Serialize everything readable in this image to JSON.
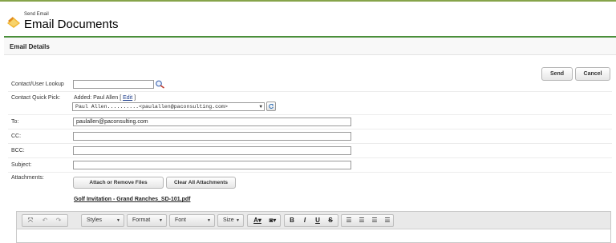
{
  "header": {
    "small_title": "Send Email",
    "title": "Email Documents"
  },
  "panel": {
    "heading": "Email Details"
  },
  "actions": {
    "send": "Send",
    "cancel": "Cancel"
  },
  "form": {
    "contact_lookup_label": "Contact/User Lookup",
    "contact_lookup_value": "",
    "quick_pick_label": "Contact Quick Pick:",
    "quick_pick_added_prefix": "Added: Paul Allen [",
    "quick_pick_edit": "Edit",
    "quick_pick_added_suffix": "]",
    "quick_pick_selected": "Paul Allen..........<paulallen@paconsulting.com>",
    "to_label": "To:",
    "to_value": "paulallen@paconsulting.com",
    "cc_label": "CC:",
    "cc_value": "",
    "bcc_label": "BCC:",
    "bcc_value": "",
    "subject_label": "Subject:",
    "subject_value": "",
    "attachments_label": "Attachments:",
    "attach_button": "Attach or Remove Files",
    "clear_button": "Clear All Attachments",
    "attachment_file": "Golf Invitation - Grand Ranches_SD-101.pdf"
  },
  "editor": {
    "styles": "Styles",
    "format": "Format",
    "font": "Font",
    "size": "Size",
    "bold": "B",
    "italic": "I",
    "underline": "U",
    "strike": "S"
  },
  "colors": {
    "accent_green": "#4a8f3a",
    "top_bar": "#86a44a"
  }
}
